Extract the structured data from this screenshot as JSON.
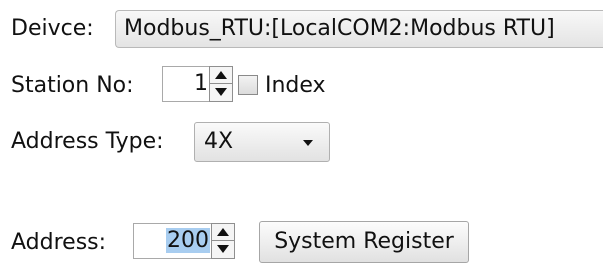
{
  "device": {
    "label": "Deivce:",
    "value": "Modbus_RTU:[LocalCOM2:Modbus RTU]"
  },
  "station": {
    "label": "Station No:",
    "value": "1",
    "index_label": "Index",
    "index_checked": false
  },
  "address_type": {
    "label": "Address Type:",
    "selected": "4X"
  },
  "address": {
    "label": "Address:",
    "value": "200",
    "system_register_button": "System Register"
  },
  "icons": {
    "spin_up": "triangle-up-icon",
    "spin_down": "triangle-down-icon",
    "dropdown": "caret-down-icon"
  },
  "colors": {
    "selection_highlight": "#a8cdf0",
    "control_border": "#a9a9a9"
  }
}
